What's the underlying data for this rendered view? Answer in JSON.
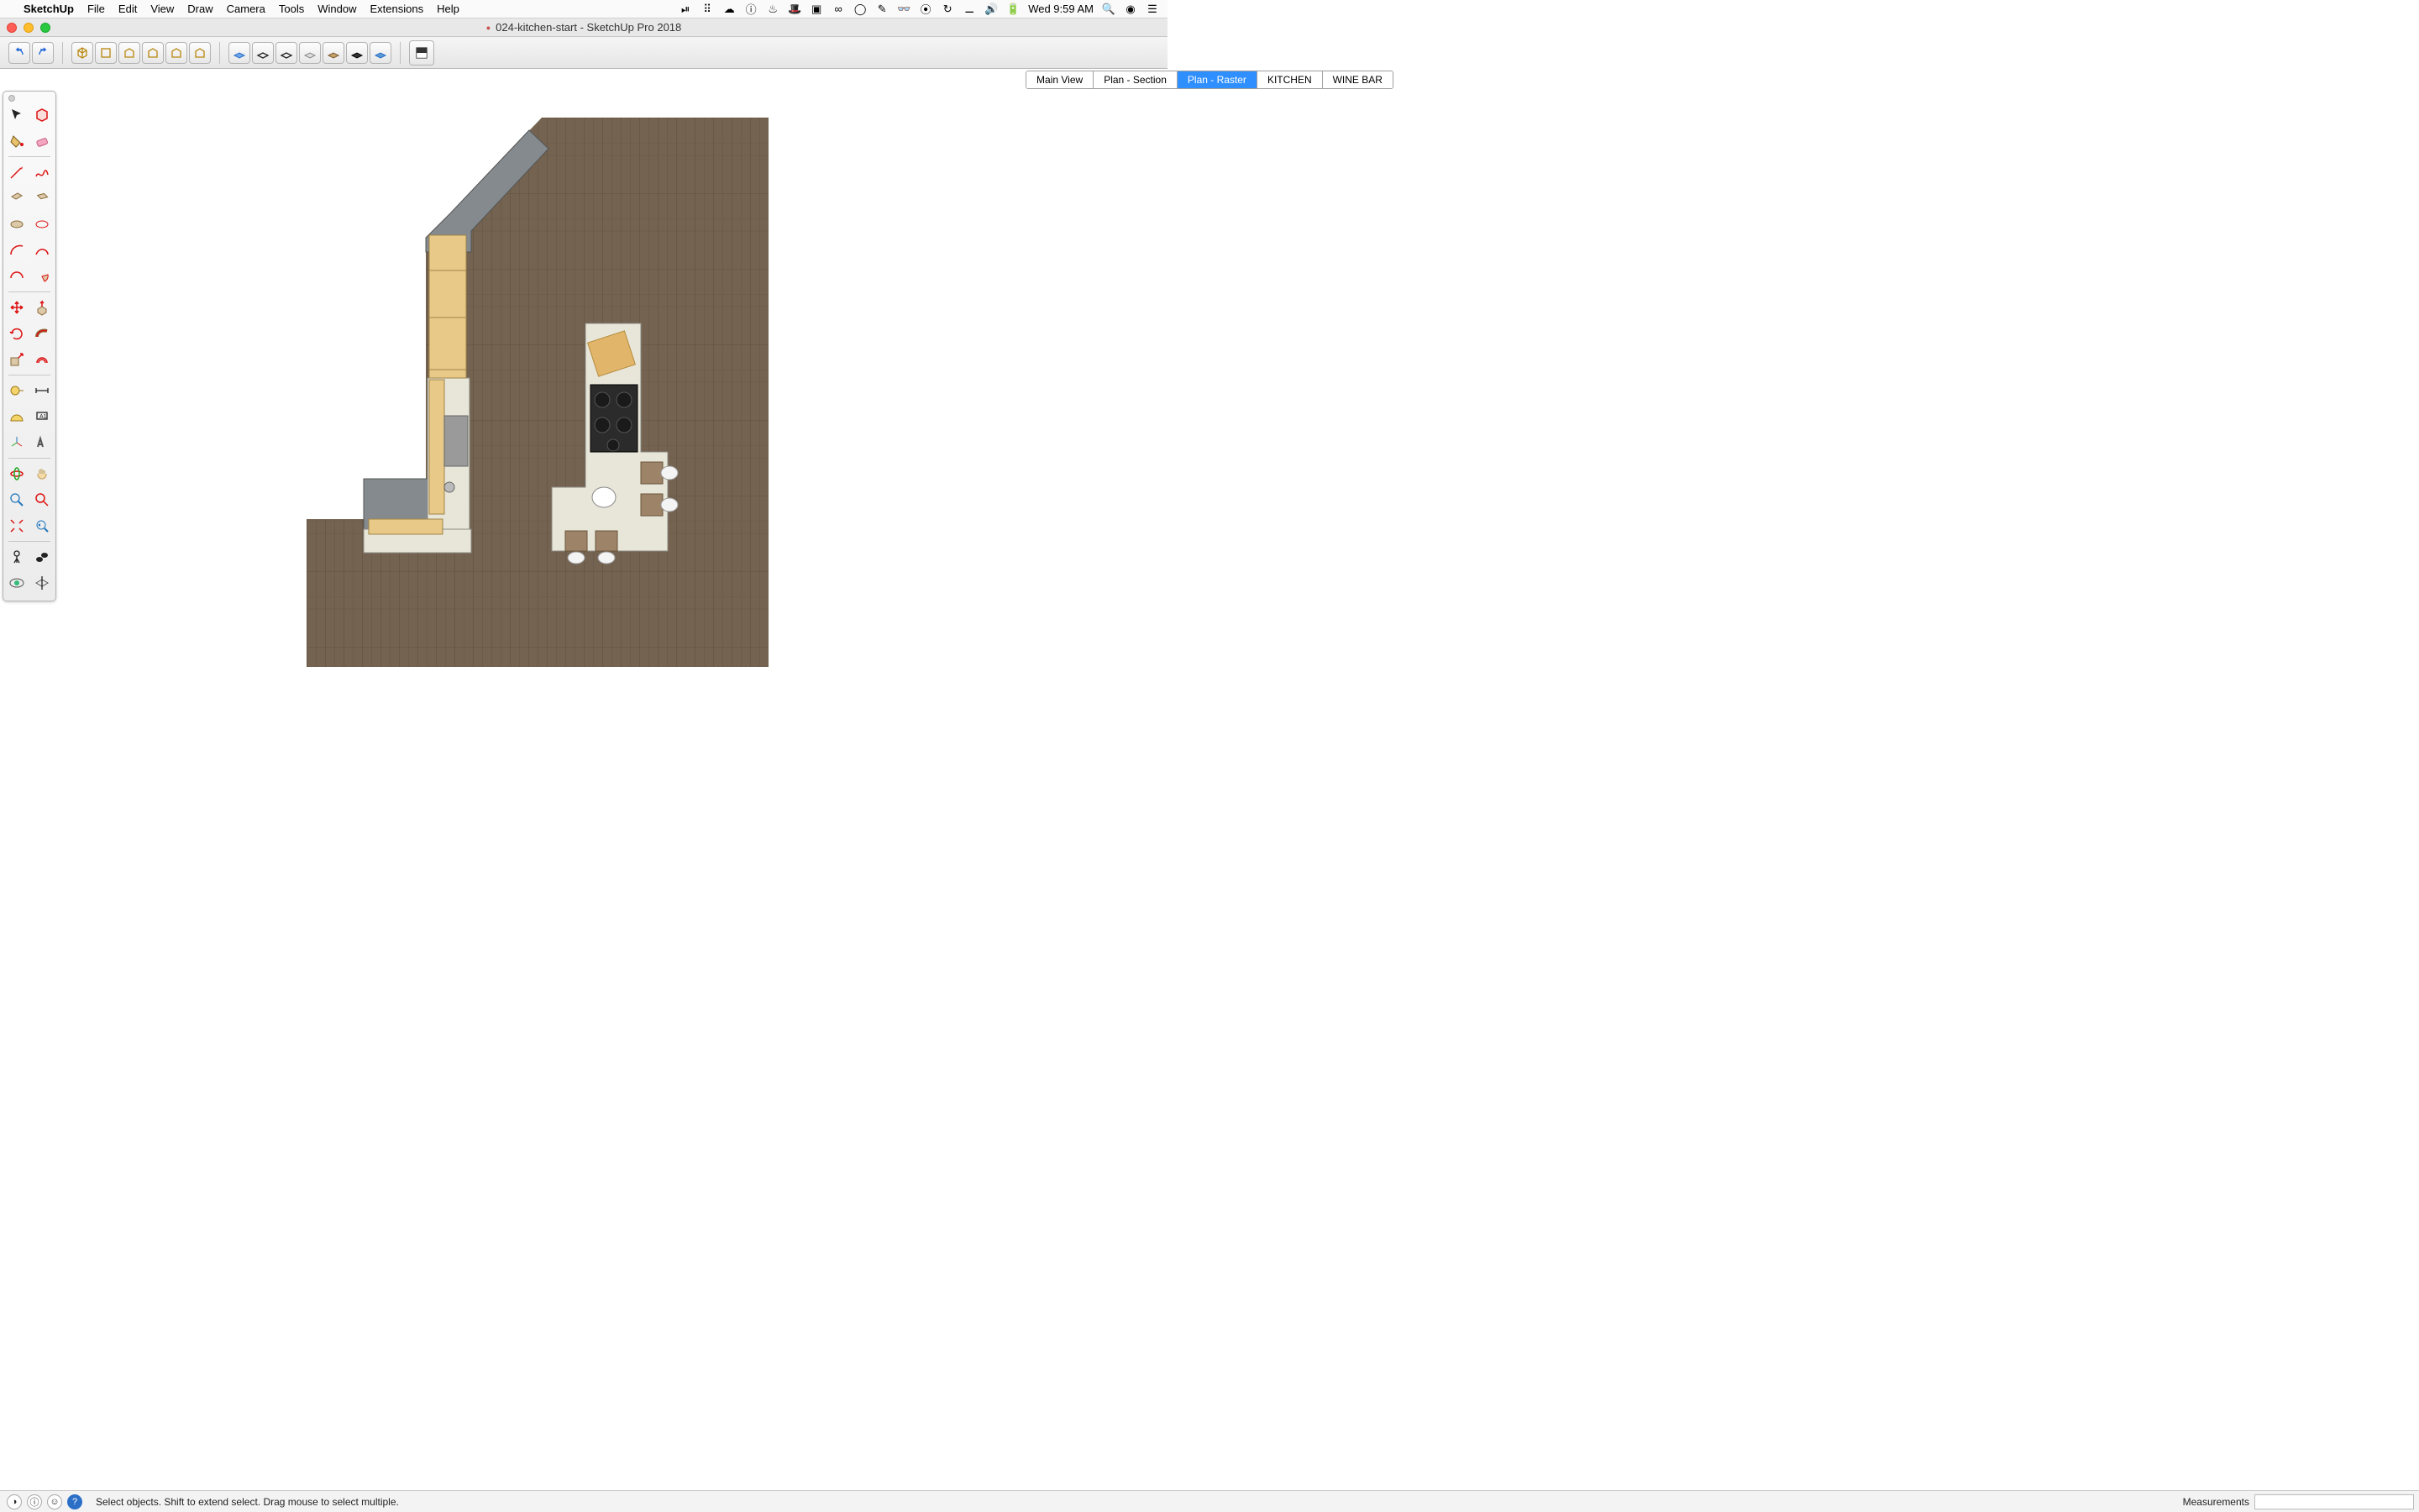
{
  "menubar": {
    "apple": "",
    "app": "SketchUp",
    "items": [
      "File",
      "Edit",
      "View",
      "Draw",
      "Camera",
      "Tools",
      "Window",
      "Extensions",
      "Help"
    ],
    "clock": "Wed 9:59 AM"
  },
  "titlebar": {
    "title": "024-kitchen-start - SketchUp Pro 2018"
  },
  "scene_tabs": {
    "items": [
      "Main View",
      "Plan - Section",
      "Plan - Raster",
      "KITCHEN",
      "WINE BAR"
    ],
    "active_index": 2
  },
  "status": {
    "hint": "Select objects. Shift to extend select. Drag mouse to select multiple.",
    "measurements_label": "Measurements",
    "measurements_value": ""
  },
  "toolbar": {
    "undo": "↶",
    "redo": "↷"
  }
}
